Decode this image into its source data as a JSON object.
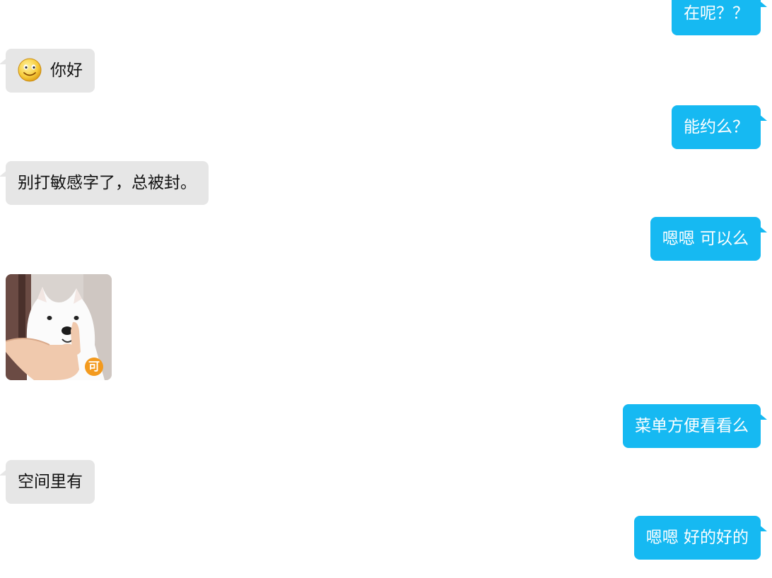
{
  "messages": [
    {
      "side": "me",
      "text": "在呢？？"
    },
    {
      "side": "them",
      "text": "你好",
      "emoji": "smiley-face-icon"
    },
    {
      "side": "me",
      "text": "能约么？"
    },
    {
      "side": "them",
      "text": "别打敏感字了，总被封。"
    },
    {
      "side": "me",
      "text": "嗯嗯 可以么"
    },
    {
      "side": "them",
      "type": "sticker",
      "sticker": "samoyed-dog-sticker",
      "badge": "可"
    },
    {
      "side": "me",
      "text": "菜单方便看看么"
    },
    {
      "side": "them",
      "text": "空间里有"
    },
    {
      "side": "me",
      "text": "嗯嗯 好的好的"
    }
  ],
  "colors": {
    "me_bubble": "#16b9f2",
    "them_bubble": "#e6e6e6",
    "badge": "#f39a1e"
  }
}
